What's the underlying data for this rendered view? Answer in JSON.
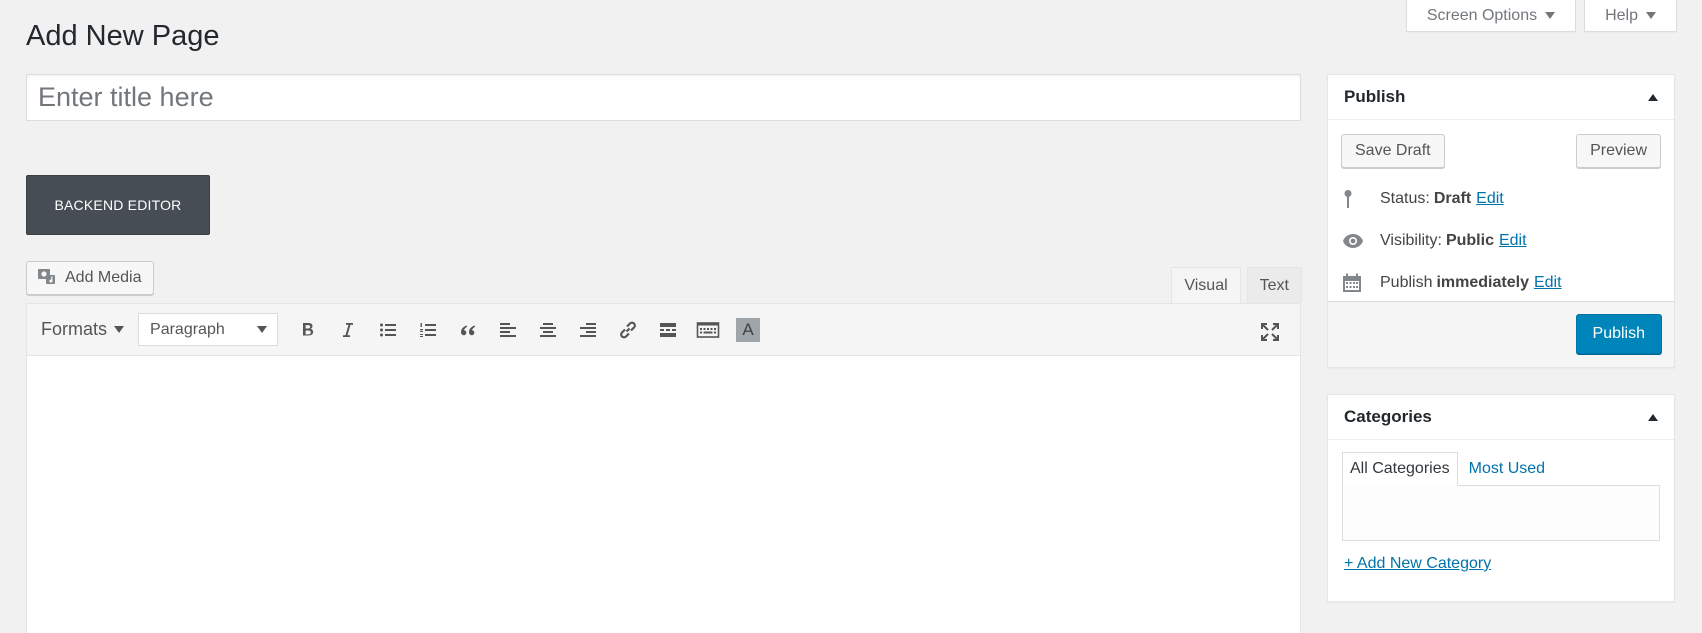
{
  "header": {
    "page_title": "Add New Page",
    "screen_options_label": "Screen Options",
    "help_label": "Help"
  },
  "title_field": {
    "placeholder": "Enter title here",
    "value": ""
  },
  "backend_editor_label": "BACKEND EDITOR",
  "media": {
    "add_media_label": "Add Media"
  },
  "editor": {
    "tabs": [
      {
        "label": "Visual",
        "active": true
      },
      {
        "label": "Text",
        "active": false
      }
    ],
    "toolbar": {
      "formats_label": "Formats",
      "block_format_value": "Paragraph",
      "buttons": [
        "bold-icon",
        "italic-icon",
        "bulleted-list-icon",
        "numbered-list-icon",
        "blockquote-icon",
        "align-left-icon",
        "align-center-icon",
        "align-right-icon",
        "insert-link-icon",
        "read-more-icon",
        "toolbar-toggle-icon",
        "text-color-icon",
        "fullscreen-icon"
      ],
      "text_color_glyph": "A"
    },
    "content": ""
  },
  "publish_box": {
    "title": "Publish",
    "save_draft_label": "Save Draft",
    "preview_label": "Preview",
    "status_label": "Status:",
    "status_value": "Draft",
    "visibility_label": "Visibility:",
    "visibility_value": "Public",
    "publish_label": "Publish",
    "publish_value": "immediately",
    "edit_label": "Edit",
    "publish_button_label": "Publish",
    "primary_color": "#0085ba"
  },
  "categories_box": {
    "title": "Categories",
    "tabs": [
      {
        "label": "All Categories",
        "active": true
      },
      {
        "label": "Most Used",
        "active": false
      }
    ],
    "add_new_label": "+ Add New Category"
  }
}
